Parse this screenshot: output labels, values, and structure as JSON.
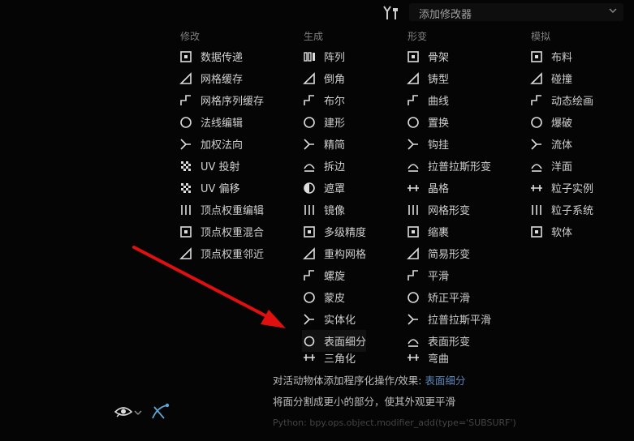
{
  "header": {
    "menu_title": "添加修改器"
  },
  "columns": [
    {
      "header": "修改",
      "items": [
        {
          "label": "数据传递",
          "icon": "data-transfer-icon"
        },
        {
          "label": "网格缓存",
          "icon": "mesh-cache-icon"
        },
        {
          "label": "网格序列缓存",
          "icon": "mesh-sequence-cache-icon"
        },
        {
          "label": "法线编辑",
          "icon": "normal-edit-icon"
        },
        {
          "label": "加权法向",
          "icon": "weighted-normal-icon"
        },
        {
          "label": "UV 投射",
          "icon": "uv-project-icon"
        },
        {
          "label": "UV 偏移",
          "icon": "uv-warp-icon"
        },
        {
          "label": "顶点权重编辑",
          "icon": "vertex-weight-edit-icon"
        },
        {
          "label": "顶点权重混合",
          "icon": "vertex-weight-mix-icon"
        },
        {
          "label": "顶点权重邻近",
          "icon": "vertex-weight-proximity-icon"
        }
      ]
    },
    {
      "header": "生成",
      "items": [
        {
          "label": "阵列",
          "icon": "array-icon"
        },
        {
          "label": "倒角",
          "icon": "bevel-icon"
        },
        {
          "label": "布尔",
          "icon": "boolean-icon"
        },
        {
          "label": "建形",
          "icon": "build-icon"
        },
        {
          "label": "精简",
          "icon": "decimate-icon"
        },
        {
          "label": "拆边",
          "icon": "edge-split-icon"
        },
        {
          "label": "遮罩",
          "icon": "mask-icon"
        },
        {
          "label": "镜像",
          "icon": "mirror-icon"
        },
        {
          "label": "多级精度",
          "icon": "multires-icon"
        },
        {
          "label": "重构网格",
          "icon": "remesh-icon"
        },
        {
          "label": "螺旋",
          "icon": "screw-icon"
        },
        {
          "label": "蒙皮",
          "icon": "skin-icon"
        },
        {
          "label": "实体化",
          "icon": "solidify-icon"
        },
        {
          "label": "表面细分",
          "icon": "subdivision-surface-icon"
        },
        {
          "label": "三角化",
          "icon": "triangulate-icon"
        }
      ]
    },
    {
      "header": "形变",
      "items": [
        {
          "label": "骨架",
          "icon": "armature-icon"
        },
        {
          "label": "铸型",
          "icon": "cast-icon"
        },
        {
          "label": "曲线",
          "icon": "curve-icon"
        },
        {
          "label": "置换",
          "icon": "displace-icon"
        },
        {
          "label": "钩挂",
          "icon": "hook-icon"
        },
        {
          "label": "拉普拉斯形变",
          "icon": "laplacian-deform-icon"
        },
        {
          "label": "晶格",
          "icon": "lattice-icon"
        },
        {
          "label": "网格形变",
          "icon": "mesh-deform-icon"
        },
        {
          "label": "缩裹",
          "icon": "shrinkwrap-icon"
        },
        {
          "label": "简易形变",
          "icon": "simple-deform-icon"
        },
        {
          "label": "平滑",
          "icon": "smooth-icon"
        },
        {
          "label": "矫正平滑",
          "icon": "corrective-smooth-icon"
        },
        {
          "label": "拉普拉斯平滑",
          "icon": "laplacian-smooth-icon"
        },
        {
          "label": "表面形变",
          "icon": "surface-deform-icon"
        },
        {
          "label": "弯曲",
          "icon": "warp-icon"
        }
      ]
    },
    {
      "header": "模拟",
      "items": [
        {
          "label": "布料",
          "icon": "cloth-icon"
        },
        {
          "label": "碰撞",
          "icon": "collision-icon"
        },
        {
          "label": "动态绘画",
          "icon": "dynamic-paint-icon"
        },
        {
          "label": "爆破",
          "icon": "explode-icon"
        },
        {
          "label": "流体",
          "icon": "fluid-icon"
        },
        {
          "label": "洋面",
          "icon": "ocean-icon"
        },
        {
          "label": "粒子实例",
          "icon": "particle-instance-icon"
        },
        {
          "label": "粒子系统",
          "icon": "particle-system-icon"
        },
        {
          "label": "软体",
          "icon": "soft-body-icon"
        }
      ]
    }
  ],
  "tooltip": {
    "line1_prefix": "对活动物体添加程序化操作/效果:",
    "line1_highlight": "表面细分",
    "line2": "将面分割成更小的部分，使其外观更平滑",
    "line3": "Python: bpy.ops.object.modifier_add(type='SUBSURF')"
  },
  "colors": {
    "background": "#050505",
    "text": "#cfcfcf",
    "header": "#808080",
    "highlight": "#5c86b8",
    "arrow": "#e01010"
  }
}
